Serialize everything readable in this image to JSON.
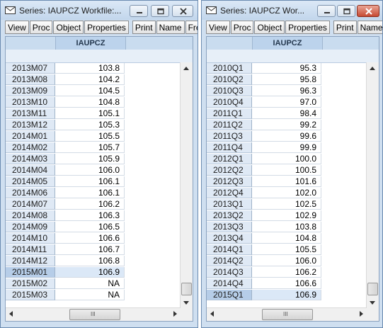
{
  "windows": [
    {
      "title": "Series: IAUPCZ   Workfile:...",
      "toolbar": [
        "View",
        "Proc",
        "Object",
        "Properties",
        "Print",
        "Name",
        "Freeze"
      ],
      "column_header": "IAUPCZ",
      "rows": [
        {
          "label": "2013M07",
          "value": "103.8"
        },
        {
          "label": "2013M08",
          "value": "104.2"
        },
        {
          "label": "2013M09",
          "value": "104.5"
        },
        {
          "label": "2013M10",
          "value": "104.8"
        },
        {
          "label": "2013M11",
          "value": "105.1"
        },
        {
          "label": "2013M12",
          "value": "105.3"
        },
        {
          "label": "2014M01",
          "value": "105.5"
        },
        {
          "label": "2014M02",
          "value": "105.7"
        },
        {
          "label": "2014M03",
          "value": "105.9"
        },
        {
          "label": "2014M04",
          "value": "106.0"
        },
        {
          "label": "2014M05",
          "value": "106.1"
        },
        {
          "label": "2014M06",
          "value": "106.1"
        },
        {
          "label": "2014M07",
          "value": "106.2"
        },
        {
          "label": "2014M08",
          "value": "106.3"
        },
        {
          "label": "2014M09",
          "value": "106.5"
        },
        {
          "label": "2014M10",
          "value": "106.6"
        },
        {
          "label": "2014M11",
          "value": "106.7"
        },
        {
          "label": "2014M12",
          "value": "106.8"
        },
        {
          "label": "2015M01",
          "value": "106.9",
          "selected": true
        },
        {
          "label": "2015M02",
          "value": "NA"
        },
        {
          "label": "2015M03",
          "value": "NA"
        }
      ],
      "hscroll_grip": "III"
    },
    {
      "title": "Series: IAUPCZ   Wor...",
      "toolbar": [
        "View",
        "Proc",
        "Object",
        "Properties",
        "Print",
        "Name",
        "Fr"
      ],
      "column_header": "IAUPCZ",
      "rows": [
        {
          "label": "2010Q1",
          "value": "95.3"
        },
        {
          "label": "2010Q2",
          "value": "95.8"
        },
        {
          "label": "2010Q3",
          "value": "96.3"
        },
        {
          "label": "2010Q4",
          "value": "97.0"
        },
        {
          "label": "2011Q1",
          "value": "98.4"
        },
        {
          "label": "2011Q2",
          "value": "99.2"
        },
        {
          "label": "2011Q3",
          "value": "99.6"
        },
        {
          "label": "2011Q4",
          "value": "99.9"
        },
        {
          "label": "2012Q1",
          "value": "100.0"
        },
        {
          "label": "2012Q2",
          "value": "100.5"
        },
        {
          "label": "2012Q3",
          "value": "101.6"
        },
        {
          "label": "2012Q4",
          "value": "102.0"
        },
        {
          "label": "2013Q1",
          "value": "102.5"
        },
        {
          "label": "2013Q2",
          "value": "102.9"
        },
        {
          "label": "2013Q3",
          "value": "103.8"
        },
        {
          "label": "2013Q4",
          "value": "104.8"
        },
        {
          "label": "2014Q1",
          "value": "105.5"
        },
        {
          "label": "2014Q2",
          "value": "106.0"
        },
        {
          "label": "2014Q3",
          "value": "106.2"
        },
        {
          "label": "2014Q4",
          "value": "106.6"
        },
        {
          "label": "2015Q1",
          "value": "106.9",
          "selected": true
        }
      ],
      "hscroll_grip": "III"
    }
  ],
  "colors": {
    "window_frame": "#cfdff0",
    "row_label_bg": "#dfe9f5",
    "selected_label_bg": "#b6cde8",
    "close_button": "#c74a33"
  },
  "icons": [
    "series-icon",
    "minimize-icon",
    "restore-icon",
    "close-icon",
    "scroll-up-arrow-icon",
    "scroll-down-arrow-icon",
    "scroll-left-arrow-icon",
    "scroll-right-arrow-icon"
  ]
}
